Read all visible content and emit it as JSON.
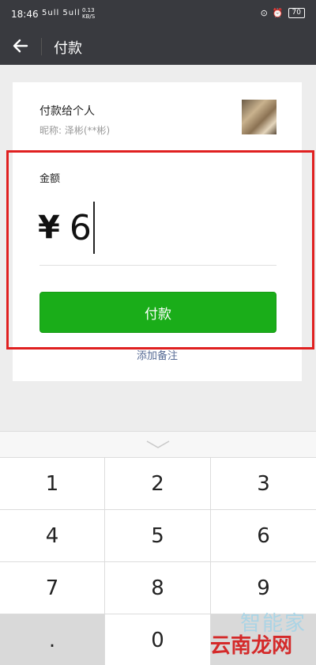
{
  "status_bar": {
    "time": "18:46",
    "signal": "5ull 5ull",
    "net_speed_value": "0.13",
    "net_speed_unit": "KB/S",
    "battery": "70"
  },
  "header": {
    "title": "付款"
  },
  "payee": {
    "title": "付款给个人",
    "nickname": "昵称: 泽彬(**彬)"
  },
  "amount": {
    "label": "金额",
    "currency": "¥",
    "value": "6"
  },
  "pay_button_label": "付款",
  "remark_link": "添加备注",
  "keyboard": {
    "keys": [
      "1",
      "2",
      "3",
      "4",
      "5",
      "6",
      "7",
      "8",
      "9",
      ".",
      "0",
      ""
    ]
  },
  "watermarks": {
    "top": "智能家",
    "bottom": "云南龙网"
  },
  "colors": {
    "header_bg": "#393a3f",
    "pay_button": "#1aad19",
    "highlight_box": "#e02020",
    "link": "#576b95"
  }
}
